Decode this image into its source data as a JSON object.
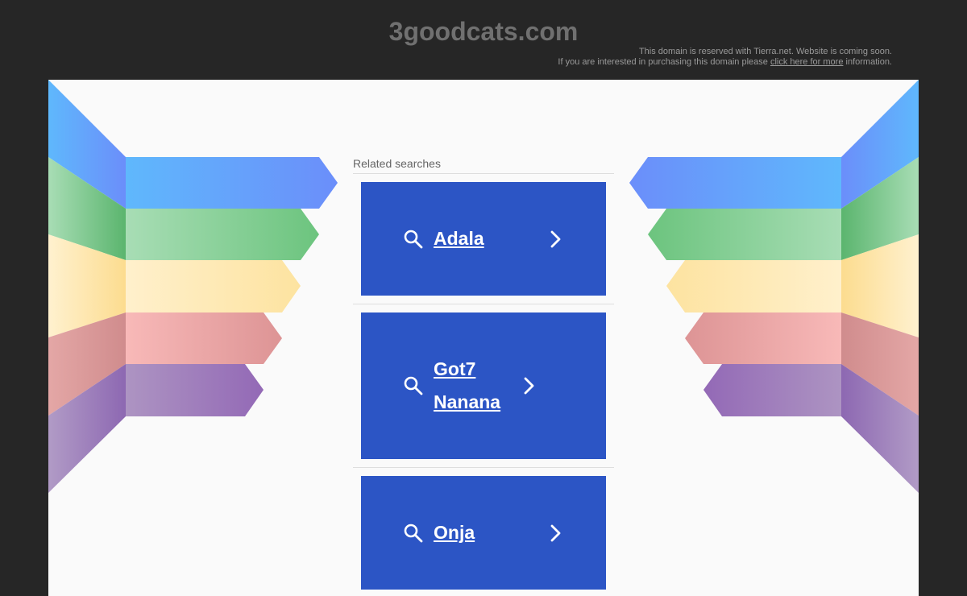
{
  "header": {
    "site_title": "3goodcats.com",
    "notice_line1": "This domain is reserved with Tierra.net. Website is coming soon.",
    "notice_line2_before": "If you are interested in purchasing this domain please",
    "notice_link": "click here for more",
    "notice_line2_after": "information."
  },
  "related": {
    "title": "Related searches",
    "items": [
      {
        "label": "Adala"
      },
      {
        "label": "Got7 Nanana"
      },
      {
        "label": "Onja"
      }
    ]
  },
  "colors": {
    "background": "#262626",
    "panel": "#fafafa",
    "button": "#2c55c5",
    "stripe_blue": "#5fb8fc",
    "stripe_green": "#6cc47e",
    "stripe_yellow": "#fde3a0",
    "stripe_red": "#e39da0",
    "stripe_purple": "#9b7bbd"
  }
}
